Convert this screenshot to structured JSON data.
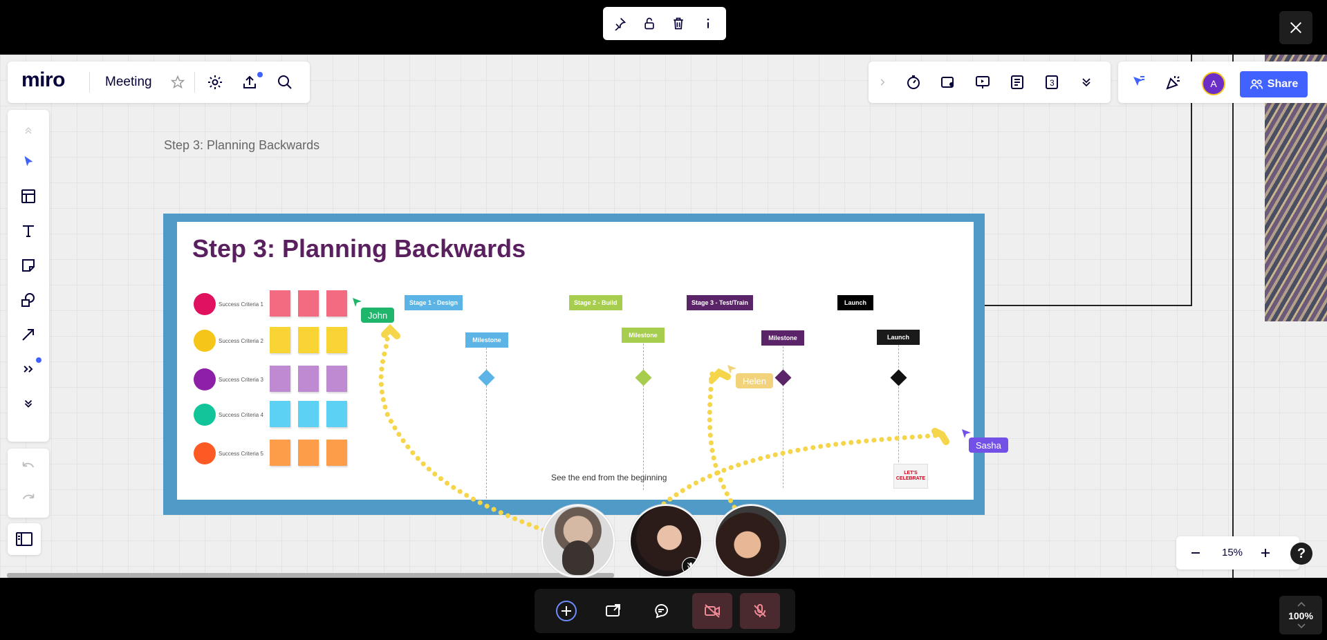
{
  "app": {
    "logo": "miro",
    "board_title": "Meeting",
    "share_label": "Share",
    "user_initial": "A"
  },
  "frame": {
    "caption": "Step 3: Planning Backwards",
    "heading": "Step 3: Planning Backwards",
    "footer_text": "See the end from the beginning",
    "criteria": [
      {
        "label": "Success Criteria 1",
        "color": "#e0115f",
        "sticky": "#f26b80"
      },
      {
        "label": "Success Criteria 2",
        "color": "#f5c518",
        "sticky": "#f8d434"
      },
      {
        "label": "Success Criteria 3",
        "color": "#8e1fa7",
        "sticky": "#c08ad2"
      },
      {
        "label": "Success Criteria 4",
        "color": "#12c49a",
        "sticky": "#5cd1f3"
      },
      {
        "label": "Success Criteria 5",
        "color": "#fb5a25",
        "sticky": "#fd9d49"
      }
    ],
    "stages": [
      {
        "label": "Stage 1 - Design",
        "color": "#5bb3e6"
      },
      {
        "label": "Stage 2 - Build",
        "color": "#a6cd4e"
      },
      {
        "label": "Stage 3 - Test/Train",
        "color": "#5c2468"
      },
      {
        "label": "Launch",
        "color": "#000000"
      }
    ],
    "milestones": [
      {
        "label": "Milestone",
        "color": "#5bb3e6"
      },
      {
        "label": "Milestone",
        "color": "#a6cd4e"
      },
      {
        "label": "Milestone",
        "color": "#5c2468"
      },
      {
        "label": "Launch",
        "color": "#1a1a1a"
      }
    ],
    "sticker_text": "LET'S CELEBRATE"
  },
  "cursors": [
    {
      "name": "John",
      "color": "#1fb56b"
    },
    {
      "name": "Helen",
      "color": "#f2d27a"
    },
    {
      "name": "Sasha",
      "color": "#7451e6"
    }
  ],
  "zoom": {
    "canvas": "15%",
    "view": "100%"
  },
  "icons": {
    "object_toolbar": [
      "pin-icon",
      "lock-icon",
      "trash-icon",
      "info-icon"
    ],
    "left_toolbar": [
      "select-icon",
      "templates-icon",
      "text-icon",
      "sticky-note-icon",
      "shapes-icon",
      "pen-icon",
      "more-tools-icon",
      "collapse-icon",
      "undo-icon",
      "redo-icon"
    ],
    "bottom_bar": [
      "add-icon",
      "share-screen-icon",
      "chat-icon",
      "camera-off-icon",
      "mic-off-icon"
    ]
  }
}
